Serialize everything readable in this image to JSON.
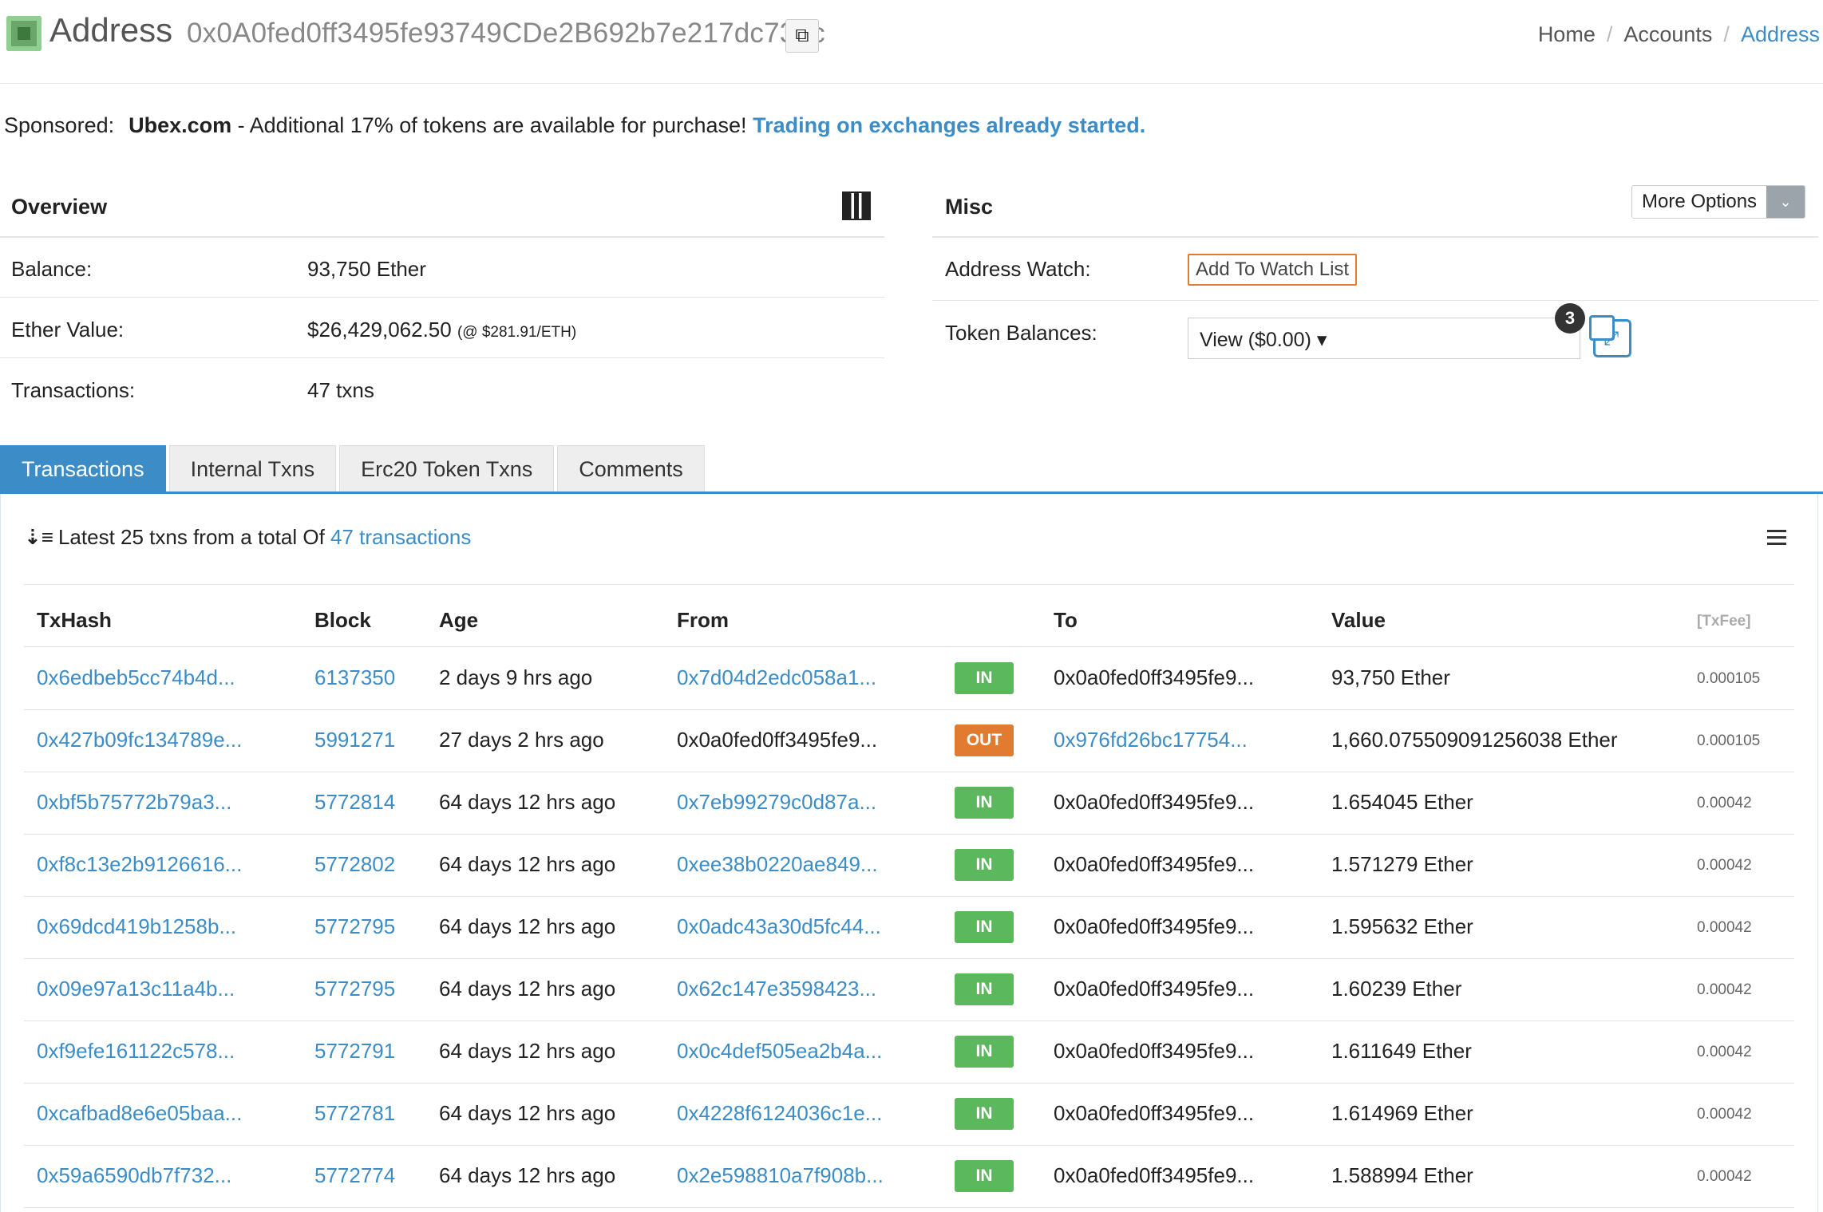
{
  "header": {
    "title": "Address",
    "address": "0x0A0fed0ff3495fe93749CDe2B692b7e217dc739c",
    "breadcrumb": [
      "Home",
      "Accounts",
      "Address"
    ]
  },
  "sponsored": {
    "label": "Sponsored:",
    "brand": "Ubex.com",
    "text": " - Additional 17% of tokens are available for purchase! ",
    "cta": "Trading on exchanges already started."
  },
  "overview": {
    "title": "Overview",
    "balance_label": "Balance:",
    "balance_value": "93,750 Ether",
    "ether_value_label": "Ether Value:",
    "ether_value": "$26,429,062.50",
    "ether_rate": "(@ $281.91/ETH)",
    "transactions_label": "Transactions:",
    "transactions_value": "47 txns"
  },
  "misc": {
    "title": "Misc",
    "more_options": "More Options",
    "address_watch_label": "Address Watch:",
    "add_watch": "Add To Watch List",
    "token_balances_label": "Token Balances:",
    "token_select": "View ($0.00) ▾",
    "token_count": "3"
  },
  "tabs": [
    "Transactions",
    "Internal Txns",
    "Erc20 Token Txns",
    "Comments"
  ],
  "summary": {
    "text": "Latest 25 txns from a total Of ",
    "link": "47 transactions"
  },
  "table": {
    "headers": {
      "txhash": "TxHash",
      "block": "Block",
      "age": "Age",
      "from": "From",
      "to": "To",
      "value": "Value",
      "fee": "[TxFee]"
    },
    "rows": [
      {
        "txhash": "0x6edbeb5cc74b4d...",
        "block": "6137350",
        "age": "2 days 9 hrs ago",
        "from": "0x7d04d2edc058a1...",
        "dir": "IN",
        "to": "0x0a0fed0ff3495fe9...",
        "value": "93,750 Ether",
        "fee": "0.000105"
      },
      {
        "txhash": "0x427b09fc134789e...",
        "block": "5991271",
        "age": "27 days 2 hrs ago",
        "from": "0x0a0fed0ff3495fe9...",
        "dir": "OUT",
        "to": "0x976fd26bc17754...",
        "value": "1,660.075509091256038 Ether",
        "fee": "0.000105"
      },
      {
        "txhash": "0xbf5b75772b79a3...",
        "block": "5772814",
        "age": "64 days 12 hrs ago",
        "from": "0x7eb99279c0d87a...",
        "dir": "IN",
        "to": "0x0a0fed0ff3495fe9...",
        "value": "1.654045 Ether",
        "fee": "0.00042"
      },
      {
        "txhash": "0xf8c13e2b9126616...",
        "block": "5772802",
        "age": "64 days 12 hrs ago",
        "from": "0xee38b0220ae849...",
        "dir": "IN",
        "to": "0x0a0fed0ff3495fe9...",
        "value": "1.571279 Ether",
        "fee": "0.00042"
      },
      {
        "txhash": "0x69dcd419b1258b...",
        "block": "5772795",
        "age": "64 days 12 hrs ago",
        "from": "0x0adc43a30d5fc44...",
        "dir": "IN",
        "to": "0x0a0fed0ff3495fe9...",
        "value": "1.595632 Ether",
        "fee": "0.00042"
      },
      {
        "txhash": "0x09e97a13c11a4b...",
        "block": "5772795",
        "age": "64 days 12 hrs ago",
        "from": "0x62c147e3598423...",
        "dir": "IN",
        "to": "0x0a0fed0ff3495fe9...",
        "value": "1.60239 Ether",
        "fee": "0.00042"
      },
      {
        "txhash": "0xf9efe161122c578...",
        "block": "5772791",
        "age": "64 days 12 hrs ago",
        "from": "0x0c4def505ea2b4a...",
        "dir": "IN",
        "to": "0x0a0fed0ff3495fe9...",
        "value": "1.611649 Ether",
        "fee": "0.00042"
      },
      {
        "txhash": "0xcafbad8e6e05baa...",
        "block": "5772781",
        "age": "64 days 12 hrs ago",
        "from": "0x4228f6124036c1e...",
        "dir": "IN",
        "to": "0x0a0fed0ff3495fe9...",
        "value": "1.614969 Ether",
        "fee": "0.00042"
      },
      {
        "txhash": "0x59a6590db7f732...",
        "block": "5772774",
        "age": "64 days 12 hrs ago",
        "from": "0x2e598810a7f908b...",
        "dir": "IN",
        "to": "0x0a0fed0ff3495fe9...",
        "value": "1.588994 Ether",
        "fee": "0.00042"
      }
    ]
  },
  "colors": {
    "accent": "#3c8dc7",
    "in": "#5cb85c",
    "out": "#e07b30"
  }
}
